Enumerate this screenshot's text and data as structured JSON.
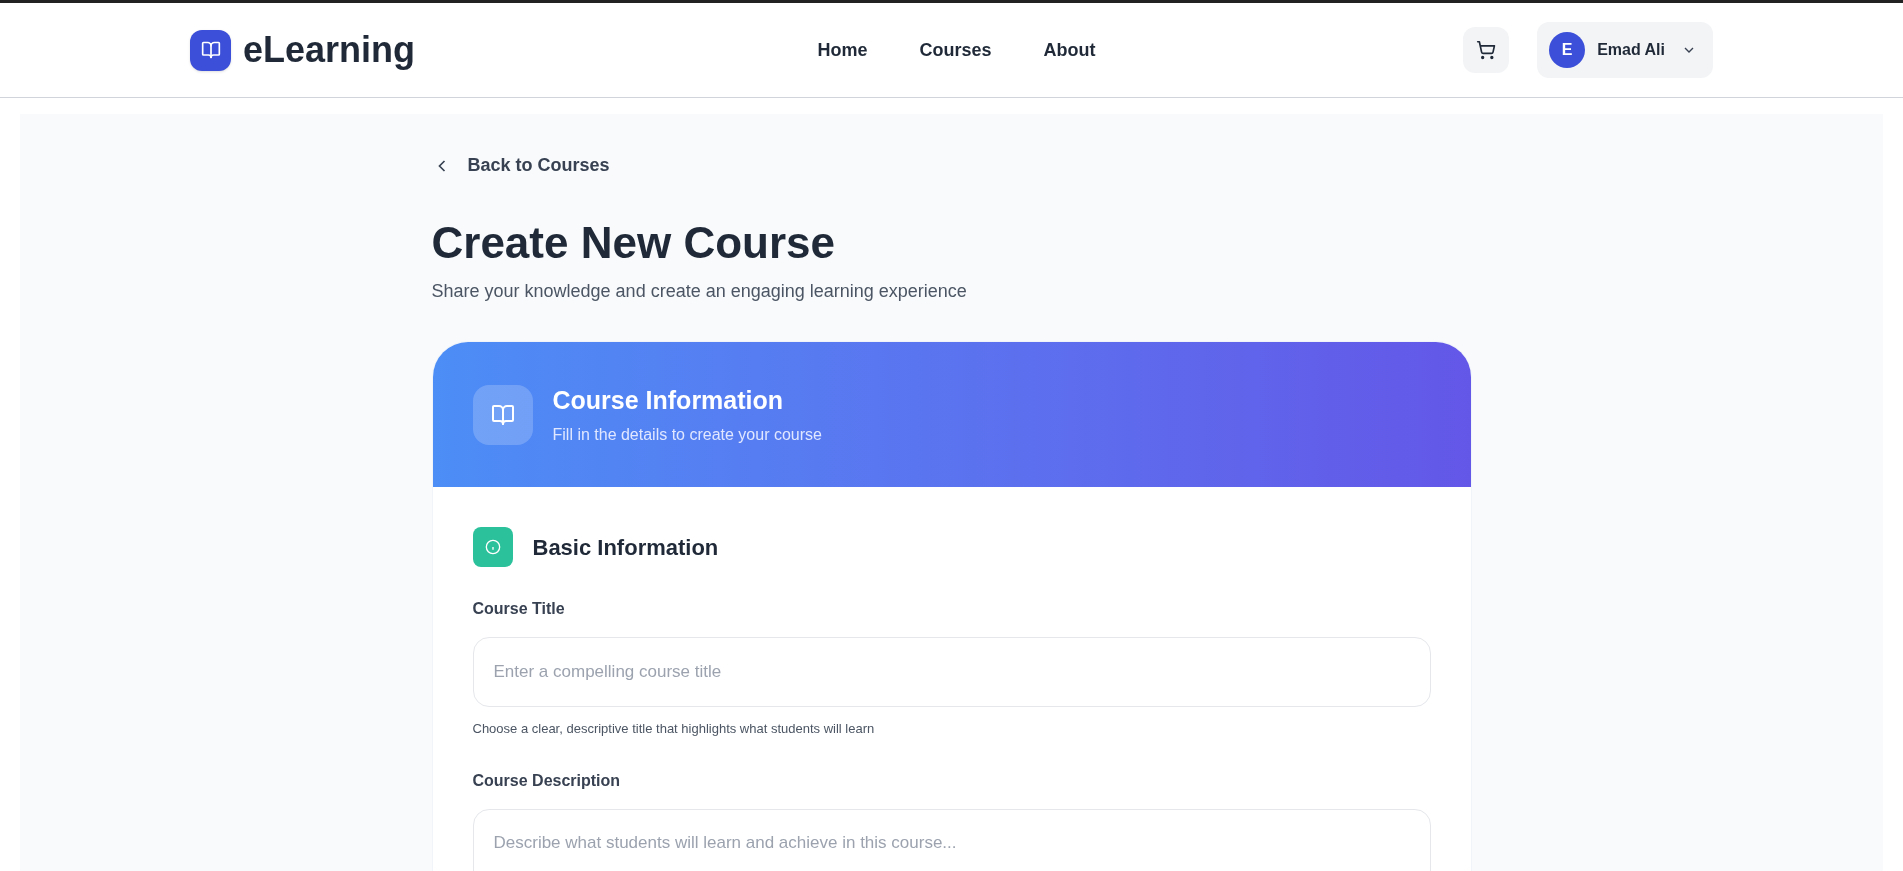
{
  "header": {
    "logo_text": "eLearning",
    "nav": [
      {
        "label": "Home"
      },
      {
        "label": "Courses"
      },
      {
        "label": "About"
      }
    ],
    "user": {
      "initial": "E",
      "name": "Emad Ali"
    }
  },
  "back_link": "Back to Courses",
  "page_title": "Create New Course",
  "page_subtitle": "Share your knowledge and create an engaging learning experience",
  "card": {
    "title": "Course Information",
    "subtitle": "Fill in the details to create your course",
    "section": {
      "title": "Basic Information"
    },
    "fields": [
      {
        "kind": "input",
        "label": "Course Title",
        "placeholder": "Enter a compelling course title",
        "hint": "Choose a clear, descriptive title that highlights what students will learn"
      },
      {
        "kind": "textarea",
        "label": "Course Description",
        "placeholder": "Describe what students will learn and achieve in this course..."
      }
    ]
  }
}
